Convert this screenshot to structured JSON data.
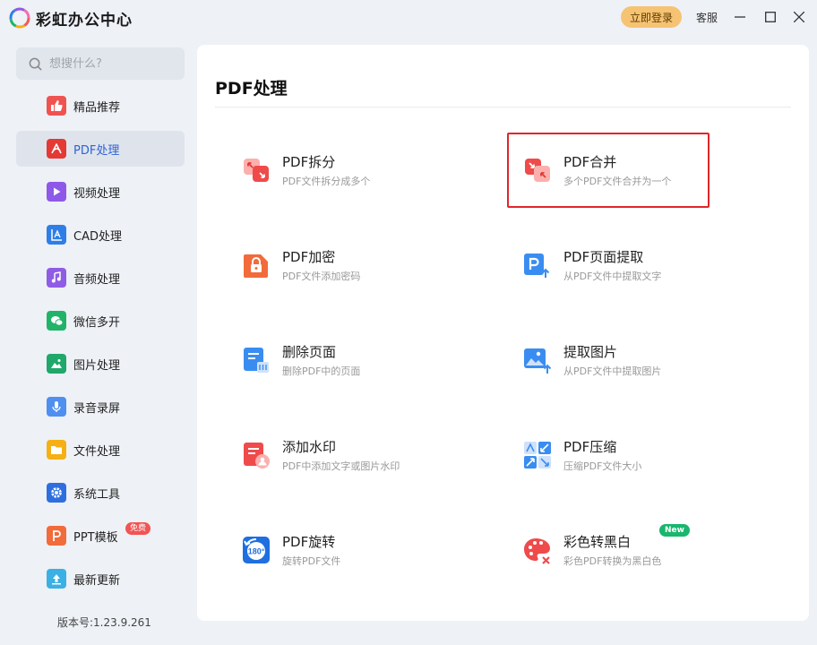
{
  "app": {
    "title": "彩虹办公中心"
  },
  "titlebar": {
    "login": "立即登录",
    "support": "客服"
  },
  "search": {
    "placeholder": "想搜什么?"
  },
  "sidebar": {
    "items": [
      {
        "label": "精品推荐",
        "icon": "thumbs-up-icon",
        "color": "#ef5350"
      },
      {
        "label": "PDF处理",
        "icon": "pdf-icon",
        "color": "#e53935",
        "active": true
      },
      {
        "label": "视频处理",
        "icon": "video-play-icon",
        "color": "#8e59e8"
      },
      {
        "label": "CAD处理",
        "icon": "cad-ruler-icon",
        "color": "#2f7ee8"
      },
      {
        "label": "音频处理",
        "icon": "music-note-icon",
        "color": "#8f5ce6"
      },
      {
        "label": "微信多开",
        "icon": "wechat-icon",
        "color": "#21b468"
      },
      {
        "label": "图片处理",
        "icon": "image-icon",
        "color": "#20a86a"
      },
      {
        "label": "录音录屏",
        "icon": "microphone-icon",
        "color": "#4e8ff0"
      },
      {
        "label": "文件处理",
        "icon": "folder-icon",
        "color": "#f5b015"
      },
      {
        "label": "系统工具",
        "icon": "gear-icon",
        "color": "#2e6fe0"
      },
      {
        "label": "PPT模板",
        "icon": "ppt-icon",
        "color": "#f26b3a",
        "badge": "免费"
      },
      {
        "label": "最新更新",
        "icon": "upload-arrow-icon",
        "color": "#3ab0e4"
      }
    ],
    "version": "版本号:1.23.9.261"
  },
  "main": {
    "title": "PDF处理",
    "tools": [
      {
        "name": "PDF拆分",
        "desc": "PDF文件拆分成多个",
        "icon": "pdf-split-icon"
      },
      {
        "name": "PDF合并",
        "desc": "多个PDF文件合并为一个",
        "icon": "pdf-merge-icon",
        "highlighted": true
      },
      {
        "name": "PDF加密",
        "desc": "PDF文件添加密码",
        "icon": "pdf-lock-icon"
      },
      {
        "name": "PDF页面提取",
        "desc": "从PDF文件中提取文字",
        "icon": "pdf-page-extract-icon"
      },
      {
        "name": "删除页面",
        "desc": "删除PDF中的页面",
        "icon": "delete-page-icon"
      },
      {
        "name": "提取图片",
        "desc": "从PDF文件中提取图片",
        "icon": "extract-image-icon"
      },
      {
        "name": "添加水印",
        "desc": "PDF中添加文字或图片水印",
        "icon": "watermark-icon"
      },
      {
        "name": "PDF压缩",
        "desc": "压缩PDF文件大小",
        "icon": "pdf-compress-icon"
      },
      {
        "name": "PDF旋转",
        "desc": "旋转PDF文件",
        "icon": "rotate-180-icon"
      },
      {
        "name": "彩色转黑白",
        "desc": "彩色PDF转换为黑白色",
        "icon": "color-to-bw-icon",
        "badge": "New"
      }
    ]
  }
}
